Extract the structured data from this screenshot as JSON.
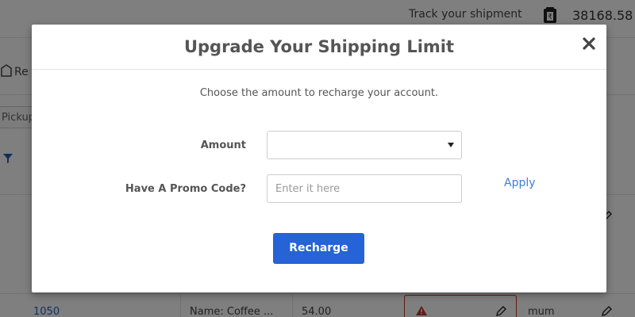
{
  "background": {
    "track_shipment": "Track your shipment",
    "wallet_balance": "38168.58",
    "toolbar_partial_label": "Re",
    "pickup_partial": "Pickup",
    "row": {
      "id": "1050",
      "name": "Name: Coffee ...",
      "amount": "54.00",
      "city_partial": "mum"
    }
  },
  "modal": {
    "title": "Upgrade Your Shipping Limit",
    "subtitle": "Choose the amount to recharge your account.",
    "amount_label": "Amount",
    "amount_value": "",
    "promo_label": "Have A Promo Code?",
    "promo_value": "",
    "promo_placeholder": "Enter it here",
    "apply_label": "Apply",
    "recharge_label": "Recharge"
  },
  "colors": {
    "primary_button": "#2563d6",
    "link": "#3b7fd4",
    "overlay": "rgba(0,0,0,0.5)",
    "alert_border": "#c0392b"
  }
}
